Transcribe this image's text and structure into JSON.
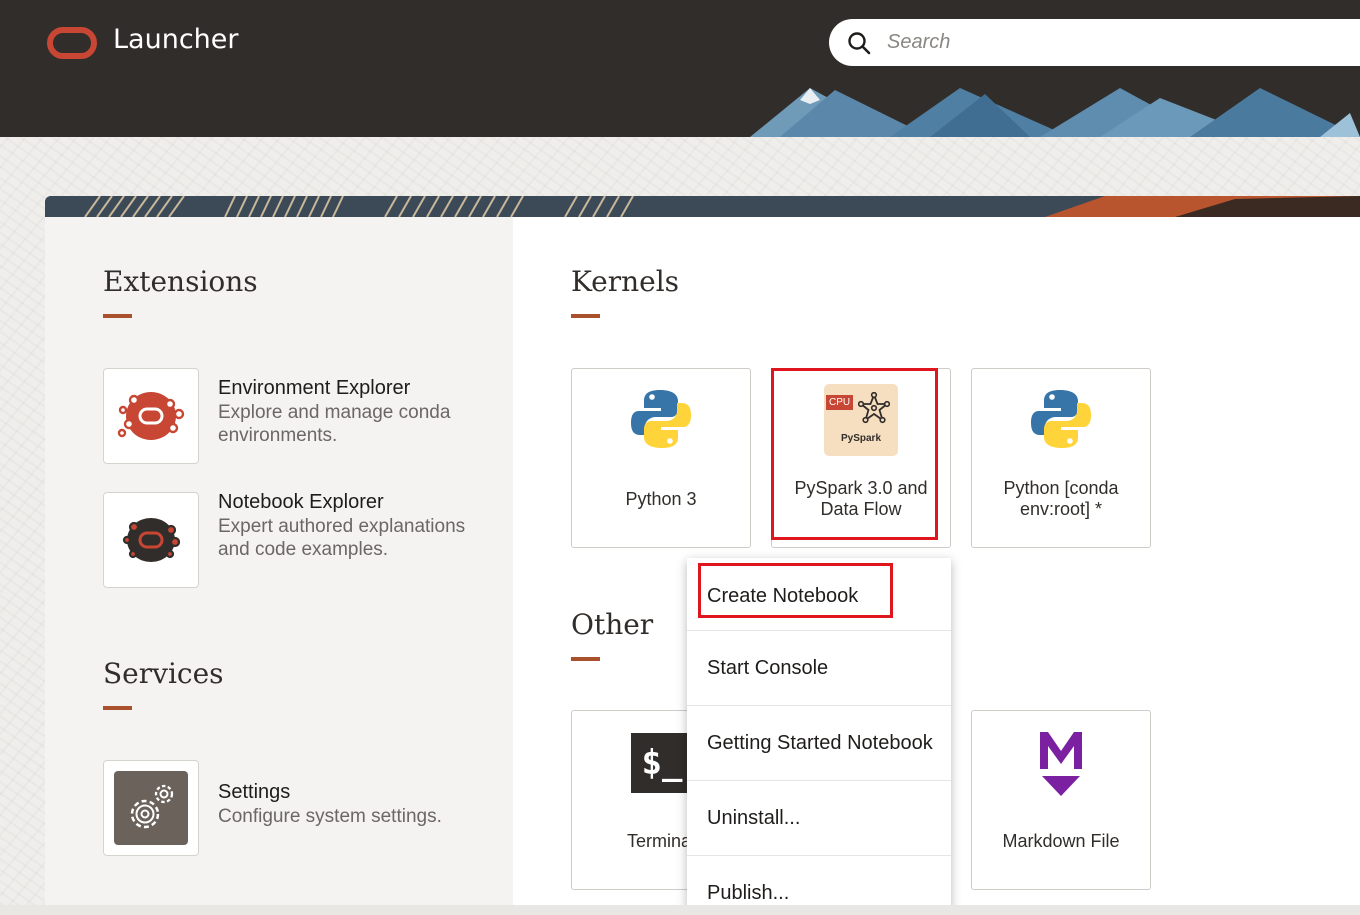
{
  "header": {
    "title": "Launcher",
    "search_placeholder": "Search"
  },
  "colors": {
    "header_bg": "#312d2a",
    "oracle_red": "#c74634",
    "accent_rule": "#a9512c",
    "highlight_red": "#e0161e",
    "python_blue": "#3775a9",
    "python_yellow": "#ffd43b",
    "markdown_purple": "#7b20a0"
  },
  "extensions": {
    "heading": "Extensions",
    "items": [
      {
        "name": "Environment Explorer",
        "description": "Explore and manage conda environments.",
        "icon": "environment-explorer-icon"
      },
      {
        "name": "Notebook Explorer",
        "description": "Expert authored explanations and code examples.",
        "icon": "notebook-explorer-icon"
      }
    ]
  },
  "services": {
    "heading": "Services",
    "items": [
      {
        "name": "Settings",
        "description": "Configure system settings.",
        "icon": "gear-icon"
      }
    ]
  },
  "kernels": {
    "heading": "Kernels",
    "items": [
      {
        "label": "Python 3",
        "icon": "python-icon"
      },
      {
        "label": "PySpark 3.0 and Data Flow",
        "icon": "pyspark-icon",
        "badge": "CPU",
        "icon_text": "PySpark"
      },
      {
        "label": "Python [conda env:root] *",
        "icon": "python-icon"
      }
    ]
  },
  "other": {
    "heading": "Other",
    "items": [
      {
        "label": "Terminal",
        "icon": "terminal-icon",
        "icon_text": "$_"
      },
      {
        "label": "Markdown File",
        "icon": "markdown-icon"
      }
    ]
  },
  "context_menu": {
    "items": [
      {
        "label": "Create Notebook"
      },
      {
        "label": "Start Console"
      },
      {
        "label": "Getting Started Notebook"
      },
      {
        "label": "Uninstall..."
      },
      {
        "label": "Publish..."
      }
    ]
  }
}
